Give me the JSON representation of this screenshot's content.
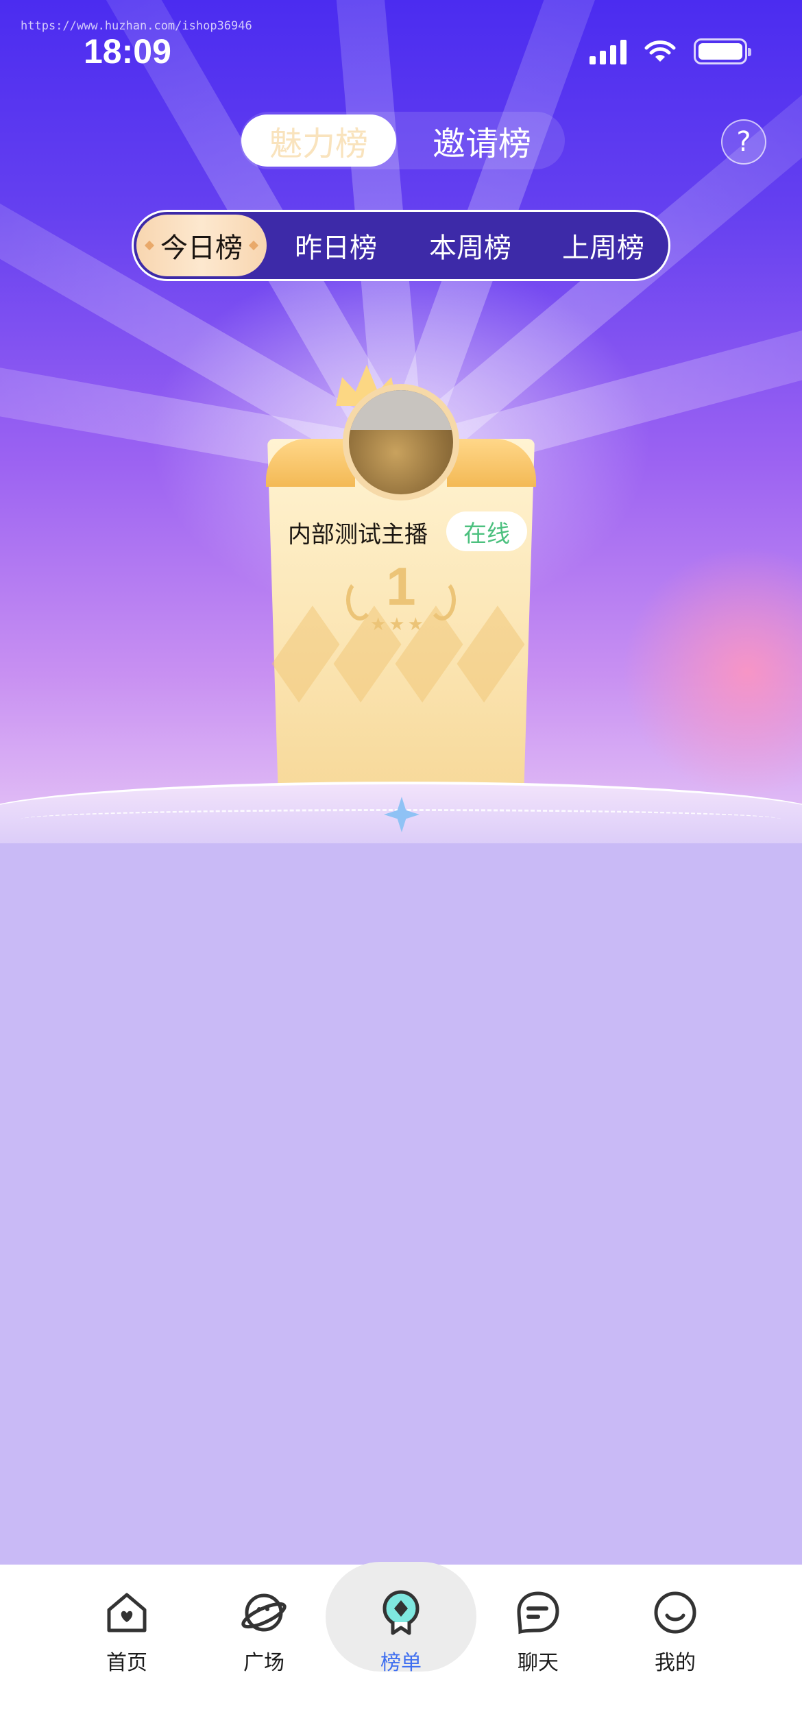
{
  "watermark": "https://www.huzhan.com/ishop36946",
  "status_bar": {
    "time": "18:09"
  },
  "ranking_type_tabs": [
    {
      "label": "魅力榜",
      "active": true
    },
    {
      "label": "邀请榜",
      "active": false
    }
  ],
  "help_button": {
    "label": "?"
  },
  "period_tabs": [
    {
      "label": "今日榜",
      "active": true
    },
    {
      "label": "昨日榜",
      "active": false
    },
    {
      "label": "本周榜",
      "active": false
    },
    {
      "label": "上周榜",
      "active": false
    }
  ],
  "top_host": {
    "name": "内部测试主播",
    "status": "在线",
    "rank": "1",
    "stars": "★★★"
  },
  "bottom_nav": [
    {
      "label": "首页",
      "icon": "home-icon",
      "active": false
    },
    {
      "label": "广场",
      "icon": "planet-icon",
      "active": false
    },
    {
      "label": "榜单",
      "icon": "ranking-badge-icon",
      "active": true
    },
    {
      "label": "聊天",
      "icon": "chat-icon",
      "active": false
    },
    {
      "label": "我的",
      "icon": "profile-icon",
      "active": false
    }
  ],
  "colors": {
    "header_purple": "#4b2cf0",
    "list_background": "#c9baf6",
    "active_nav": "#3f6ff0",
    "online_green": "#4bc07e",
    "gold": "#ecc477"
  }
}
